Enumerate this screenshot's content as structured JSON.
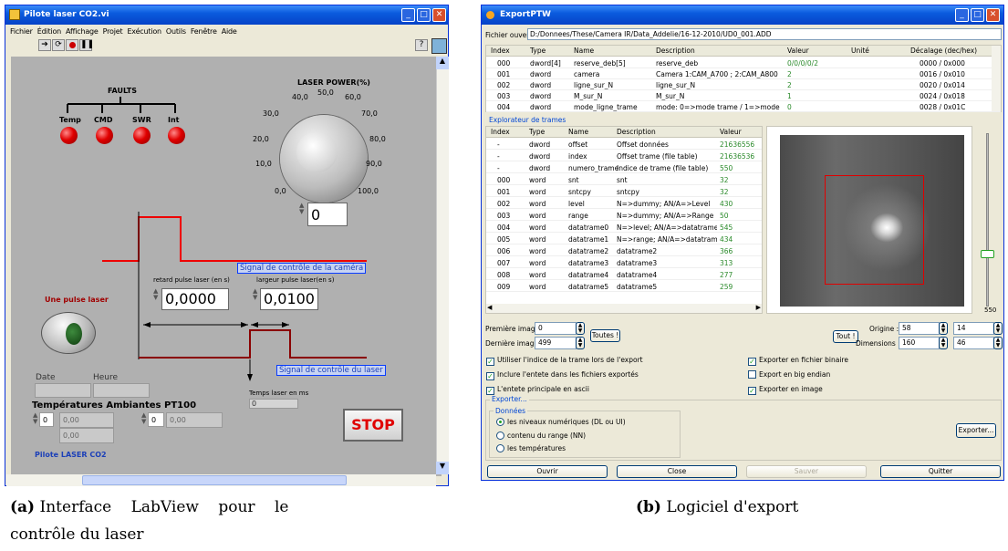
{
  "left": {
    "title": "Pilote laser CO2.vi",
    "menu": [
      "Fichier",
      "Édition",
      "Affichage",
      "Projet",
      "Exécution",
      "Outils",
      "Fenêtre",
      "Aide"
    ],
    "faults_label": "FAULTS",
    "faults": [
      "Temp",
      "CMD",
      "SWR",
      "Int"
    ],
    "power_label": "LASER POWER(%)",
    "dial_ticks": [
      "0,0",
      "10,0",
      "20,0",
      "30,0",
      "40,0",
      "50,0",
      "60,0",
      "70,0",
      "80,0",
      "90,0",
      "100,0"
    ],
    "power_value": "0",
    "signal_camera": "Signal de contrôle de la caméra",
    "signal_laser": "Signal de contrôle du laser",
    "retard_label": "retard pulse laser (en s)",
    "retard_value": "0,0000",
    "largeur_label": "largeur pulse laser(en s)",
    "largeur_value": "0,0100",
    "pulse_label": "Une pulse laser",
    "temps_label": "Temps laser en ms",
    "temps_value": "0",
    "date_label": "Date",
    "heure_label": "Heure",
    "temps_amb_label": "Températures Ambiantes",
    "pt100_label": "PT100",
    "amb_index": "0",
    "amb_v1": "0,00",
    "amb_v2": "0,00",
    "pt_index": "0",
    "pt_v1": "0,00",
    "stop_label": "STOP",
    "footer": "Pilote LASER CO2",
    "help": "?"
  },
  "right": {
    "title": "ExportPTW",
    "file_label": "Fichier ouvert:",
    "file_path": "D:/Donnees/These/Camera IR/Data_Addelie/16-12-2010/UD0_001.ADD",
    "top_headers": [
      "Index",
      "Type",
      "Name",
      "Description",
      "Valeur",
      "Unité",
      "Décalage (dec/hex)"
    ],
    "top_rows": [
      [
        "000",
        "dword[4]",
        "reserve_deb[5]",
        "reserve_deb",
        "0/0/0/0/2",
        "",
        "0000 / 0x000"
      ],
      [
        "001",
        "dword",
        "camera",
        "Camera 1:CAM_A700 ; 2:CAM_A800",
        "2",
        "",
        "0016 / 0x010"
      ],
      [
        "002",
        "dword",
        "ligne_sur_N",
        "ligne_sur_N",
        "2",
        "",
        "0020 / 0x014"
      ],
      [
        "003",
        "dword",
        "M_sur_N",
        "M_sur_N",
        "1",
        "",
        "0024 / 0x018"
      ],
      [
        "004",
        "dword",
        "mode_ligne_trame",
        "mode: 0=>mode trame / 1=>mode ligne",
        "0",
        "",
        "0028 / 0x01C"
      ]
    ],
    "explorer_label": "Explorateur de trames",
    "frame_headers": [
      "Index",
      "Type",
      "Name",
      "Description",
      "Valeur"
    ],
    "frame_rows": [
      [
        "-",
        "dword",
        "offset",
        "Offset données",
        "21636556"
      ],
      [
        "-",
        "dword",
        "index",
        "Offset trame (file table)",
        "21636536"
      ],
      [
        "-",
        "dword",
        "numero_trame",
        "Indice de trame (file table)",
        "550"
      ],
      [
        "000",
        "word",
        "snt",
        "snt",
        "32"
      ],
      [
        "001",
        "word",
        "sntcpy",
        "sntcpy",
        "32"
      ],
      [
        "002",
        "word",
        "level",
        "N=>dummy; AN/A=>Level",
        "430"
      ],
      [
        "003",
        "word",
        "range",
        "N=>dummy; AN/A=>Range",
        "50"
      ],
      [
        "004",
        "word",
        "datatrame0",
        "N=>level; AN/A=>datatrame0",
        "545"
      ],
      [
        "005",
        "word",
        "datatrame1",
        "N=>range; AN/A=>datatrame1",
        "434"
      ],
      [
        "006",
        "word",
        "datatrame2",
        "datatrame2",
        "366"
      ],
      [
        "007",
        "word",
        "datatrame3",
        "datatrame3",
        "313"
      ],
      [
        "008",
        "word",
        "datatrame4",
        "datatrame4",
        "277"
      ],
      [
        "009",
        "word",
        "datatrame5",
        "datatrame5",
        "259"
      ]
    ],
    "slider_value": "550",
    "first_image_label": "Première image",
    "first_image": "0",
    "last_image_label": "Dernière image",
    "last_image": "499",
    "toutes": "Toutes !",
    "tout": "Tout !",
    "origine_label": "Origine :",
    "origine_x": "58",
    "origine_y": "14",
    "dim_label": "Dimensions :",
    "dim_x": "160",
    "dim_y": "46",
    "options_left": [
      "Utiliser l'indice de la trame lors de l'export",
      "Inclure l'entete dans les fichiers exportés",
      "L'entete principale en ascii"
    ],
    "options_right": [
      "Exporter en fichier binaire",
      "Export en big endian",
      "Exporter en image"
    ],
    "export_group": "Exporter...",
    "donnees_group": "Données",
    "radios": [
      "les niveaux numériques (DL ou UI)",
      "contenu du range (NN)",
      "les températures"
    ],
    "export_btn": "Exporter...",
    "buttons": [
      "Ouvrir",
      "Close",
      "Sauver",
      "Quitter"
    ]
  },
  "captions": {
    "a_tag": "(a)",
    "a_text1": "Interface LabView pour le",
    "a_text2": "contrôle du laser",
    "b_tag": "(b)",
    "b_text": "Logiciel d'export"
  }
}
